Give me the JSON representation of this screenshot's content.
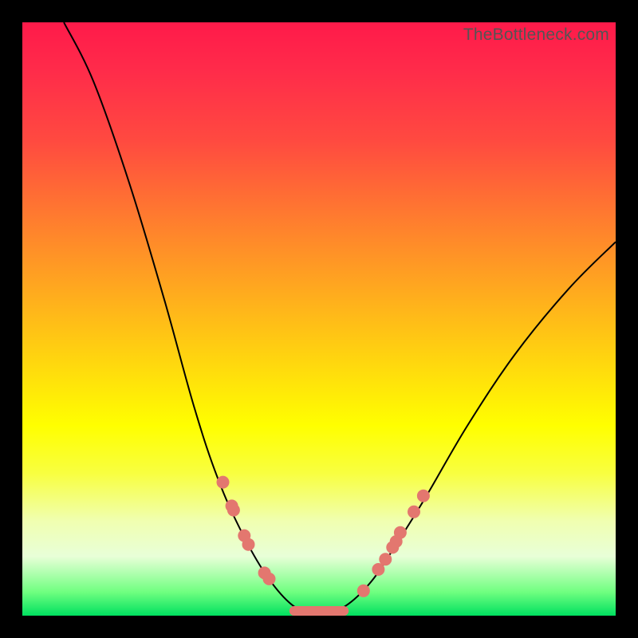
{
  "watermark": "TheBottleneck.com",
  "chart_data": {
    "type": "line",
    "title": "",
    "xlabel": "",
    "ylabel": "",
    "x_range": [
      0,
      100
    ],
    "y_range": [
      0,
      100
    ],
    "series": [
      {
        "name": "curve",
        "points": [
          {
            "x": 7,
            "y": 100
          },
          {
            "x": 12,
            "y": 90
          },
          {
            "x": 18,
            "y": 73
          },
          {
            "x": 24,
            "y": 53
          },
          {
            "x": 29,
            "y": 35
          },
          {
            "x": 33,
            "y": 23
          },
          {
            "x": 37,
            "y": 14
          },
          {
            "x": 41,
            "y": 7
          },
          {
            "x": 45,
            "y": 2.2
          },
          {
            "x": 48,
            "y": 0.8
          },
          {
            "x": 52,
            "y": 0.8
          },
          {
            "x": 55,
            "y": 2
          },
          {
            "x": 59,
            "y": 6
          },
          {
            "x": 63,
            "y": 12
          },
          {
            "x": 68,
            "y": 20
          },
          {
            "x": 75,
            "y": 32
          },
          {
            "x": 83,
            "y": 44
          },
          {
            "x": 92,
            "y": 55
          },
          {
            "x": 100,
            "y": 63
          }
        ]
      }
    ],
    "left_dots": [
      {
        "x": 33.8,
        "y": 22.5
      },
      {
        "x": 35.3,
        "y": 18.5
      },
      {
        "x": 35.6,
        "y": 17.8
      },
      {
        "x": 37.4,
        "y": 13.5
      },
      {
        "x": 38.1,
        "y": 12.0
      },
      {
        "x": 40.8,
        "y": 7.2
      },
      {
        "x": 41.6,
        "y": 6.2
      }
    ],
    "right_dots": [
      {
        "x": 57.5,
        "y": 4.2
      },
      {
        "x": 60.0,
        "y": 7.8
      },
      {
        "x": 61.2,
        "y": 9.5
      },
      {
        "x": 62.4,
        "y": 11.5
      },
      {
        "x": 63.0,
        "y": 12.5
      },
      {
        "x": 63.7,
        "y": 14.0
      },
      {
        "x": 66.0,
        "y": 17.5
      },
      {
        "x": 67.6,
        "y": 20.2
      }
    ],
    "valley_band_y": 0.8,
    "valley_band_x": [
      45,
      55
    ],
    "gradient_stops": [
      {
        "p": 0,
        "c": "#ff1a4a"
      },
      {
        "p": 20,
        "c": "#ff4a40"
      },
      {
        "p": 44,
        "c": "#ffa520"
      },
      {
        "p": 68,
        "c": "#ffff00"
      },
      {
        "p": 90,
        "c": "#e8ffd8"
      },
      {
        "p": 100,
        "c": "#00e060"
      }
    ]
  }
}
